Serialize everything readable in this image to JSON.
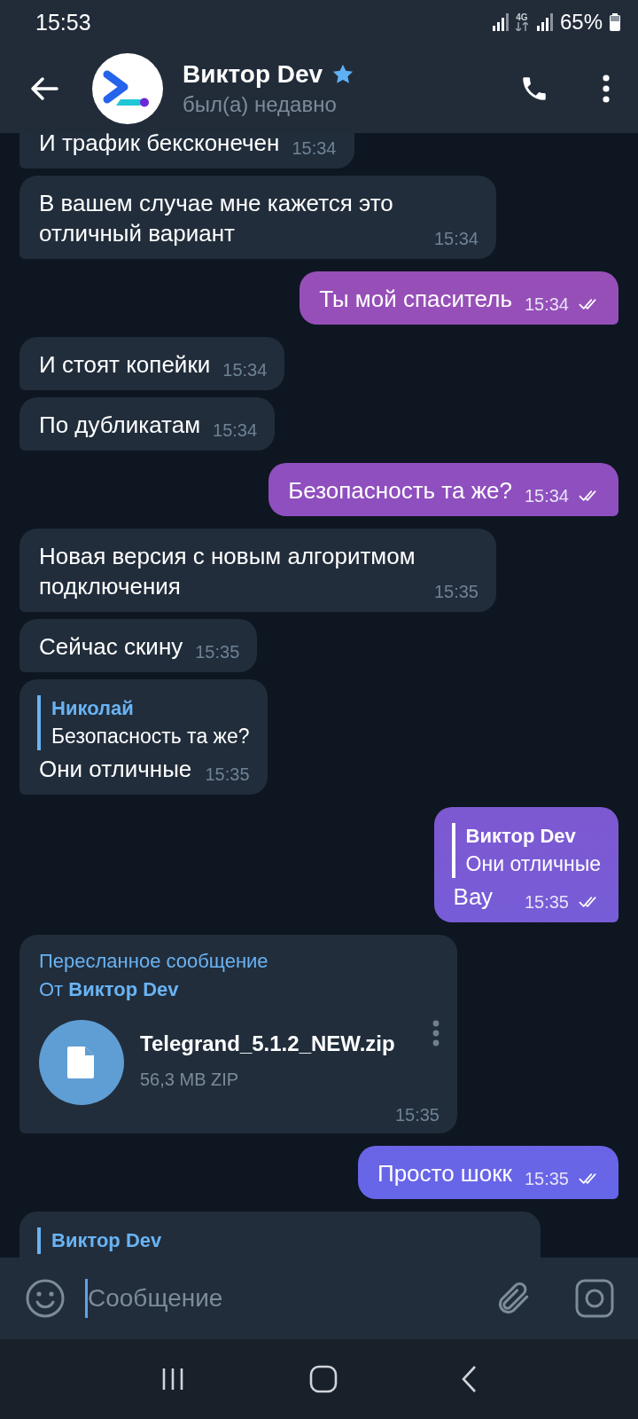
{
  "status_bar": {
    "time": "15:53",
    "network": "4G",
    "battery": "65%"
  },
  "header": {
    "name": "Виктор Dev",
    "premium": true,
    "status": "был(а) недавно"
  },
  "messages": [
    {
      "kind": "text",
      "outgoing": false,
      "text": "И трафик бексконечен",
      "time": "15:34"
    },
    {
      "kind": "text",
      "outgoing": false,
      "text": "В вашем случае мне кажется это отличный вариант",
      "time": "15:34"
    },
    {
      "kind": "text",
      "outgoing": true,
      "text": "Ты мой спаситель",
      "time": "15:34",
      "read": true
    },
    {
      "kind": "text",
      "outgoing": false,
      "text": "И стоят копейки",
      "time": "15:34"
    },
    {
      "kind": "text",
      "outgoing": false,
      "text": "По дубликатам",
      "time": "15:34"
    },
    {
      "kind": "text",
      "outgoing": true,
      "text": "Безопасность та же?",
      "time": "15:34",
      "read": true
    },
    {
      "kind": "text",
      "outgoing": false,
      "text": "Новая версия с новым алгоритмом подключения",
      "time": "15:35"
    },
    {
      "kind": "text",
      "outgoing": false,
      "text": "Сейчас скину",
      "time": "15:35"
    },
    {
      "kind": "reply",
      "outgoing": false,
      "reply_name": "Николай",
      "reply_text": "Безопасность та же?",
      "text": "Они отличные",
      "time": "15:35"
    },
    {
      "kind": "reply",
      "outgoing": true,
      "reply_name": "Виктор Dev",
      "reply_text": "Они отличные",
      "text": "Вау",
      "time": "15:35",
      "read": true
    },
    {
      "kind": "file",
      "outgoing": false,
      "forward_label": "Пересланное сообщение",
      "forward_from": "От **Виктор Dev**",
      "file_name": "Telegrand_5.1.2_NEW.zip",
      "file_size": "56,3 MB ZIP",
      "time": "15:35"
    },
    {
      "kind": "text",
      "outgoing": true,
      "text": "Просто шокк",
      "time": "15:35",
      "read": true
    },
    {
      "kind": "partial",
      "outgoing": false,
      "reply_name": "Виктор Dev"
    }
  ],
  "composer": {
    "placeholder": "Сообщение"
  }
}
